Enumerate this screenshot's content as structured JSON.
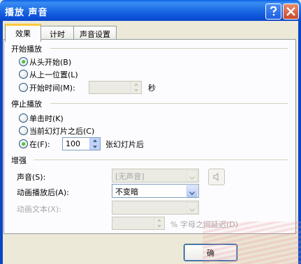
{
  "window": {
    "title": "播放 声音"
  },
  "tabs": [
    "效果",
    "计时",
    "声音设置"
  ],
  "start": {
    "title": "开始播放",
    "opt1": "从头开始(B)",
    "opt2": "从上一位置(L)",
    "opt3": "开始时间(M):",
    "seconds_unit": "秒"
  },
  "stop": {
    "title": "停止播放",
    "opt1": "单击时(K)",
    "opt2": "当前幻灯片之后(C)",
    "opt3": "在(F):",
    "after_value": "100",
    "after_unit": "张幻灯片后"
  },
  "enhance": {
    "title": "增强",
    "sound_label": "声音(S):",
    "sound_value": "[无声音]",
    "after_anim_label": "动画播放后(A):",
    "after_anim_value": "不变暗",
    "anim_text_label": "动画文本(X):",
    "anim_text_value": "",
    "delay_label": "% 字母之间延迟(D)"
  },
  "buttons": {
    "ok": "确"
  }
}
